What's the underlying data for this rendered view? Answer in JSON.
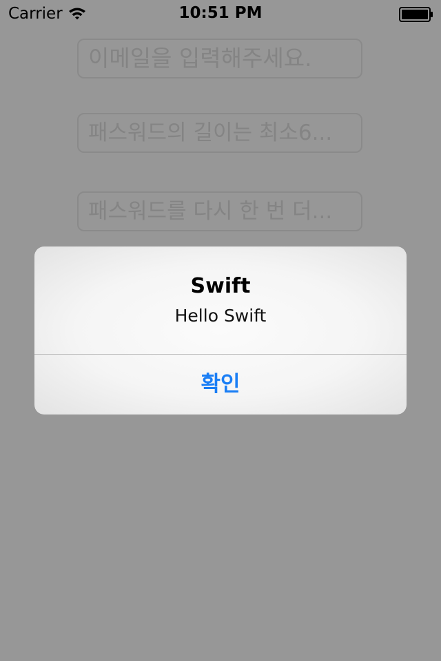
{
  "status_bar": {
    "carrier": "Carrier",
    "time": "10:51 PM",
    "wifi_icon": "wifi-icon",
    "battery_icon": "battery-icon"
  },
  "form": {
    "email_placeholder": "이메일을 입력해주세요.",
    "password_placeholder": "패스워드의 길이는 최소6...",
    "confirm_placeholder": "패스워드를 다시 한 번 더..."
  },
  "alert": {
    "title": "Swift",
    "message": "Hello Swift",
    "ok_button": "확인",
    "button_color": "#1a7ef5"
  },
  "colors": {
    "dim_background": "#979797",
    "placeholder_text": "#848484"
  }
}
